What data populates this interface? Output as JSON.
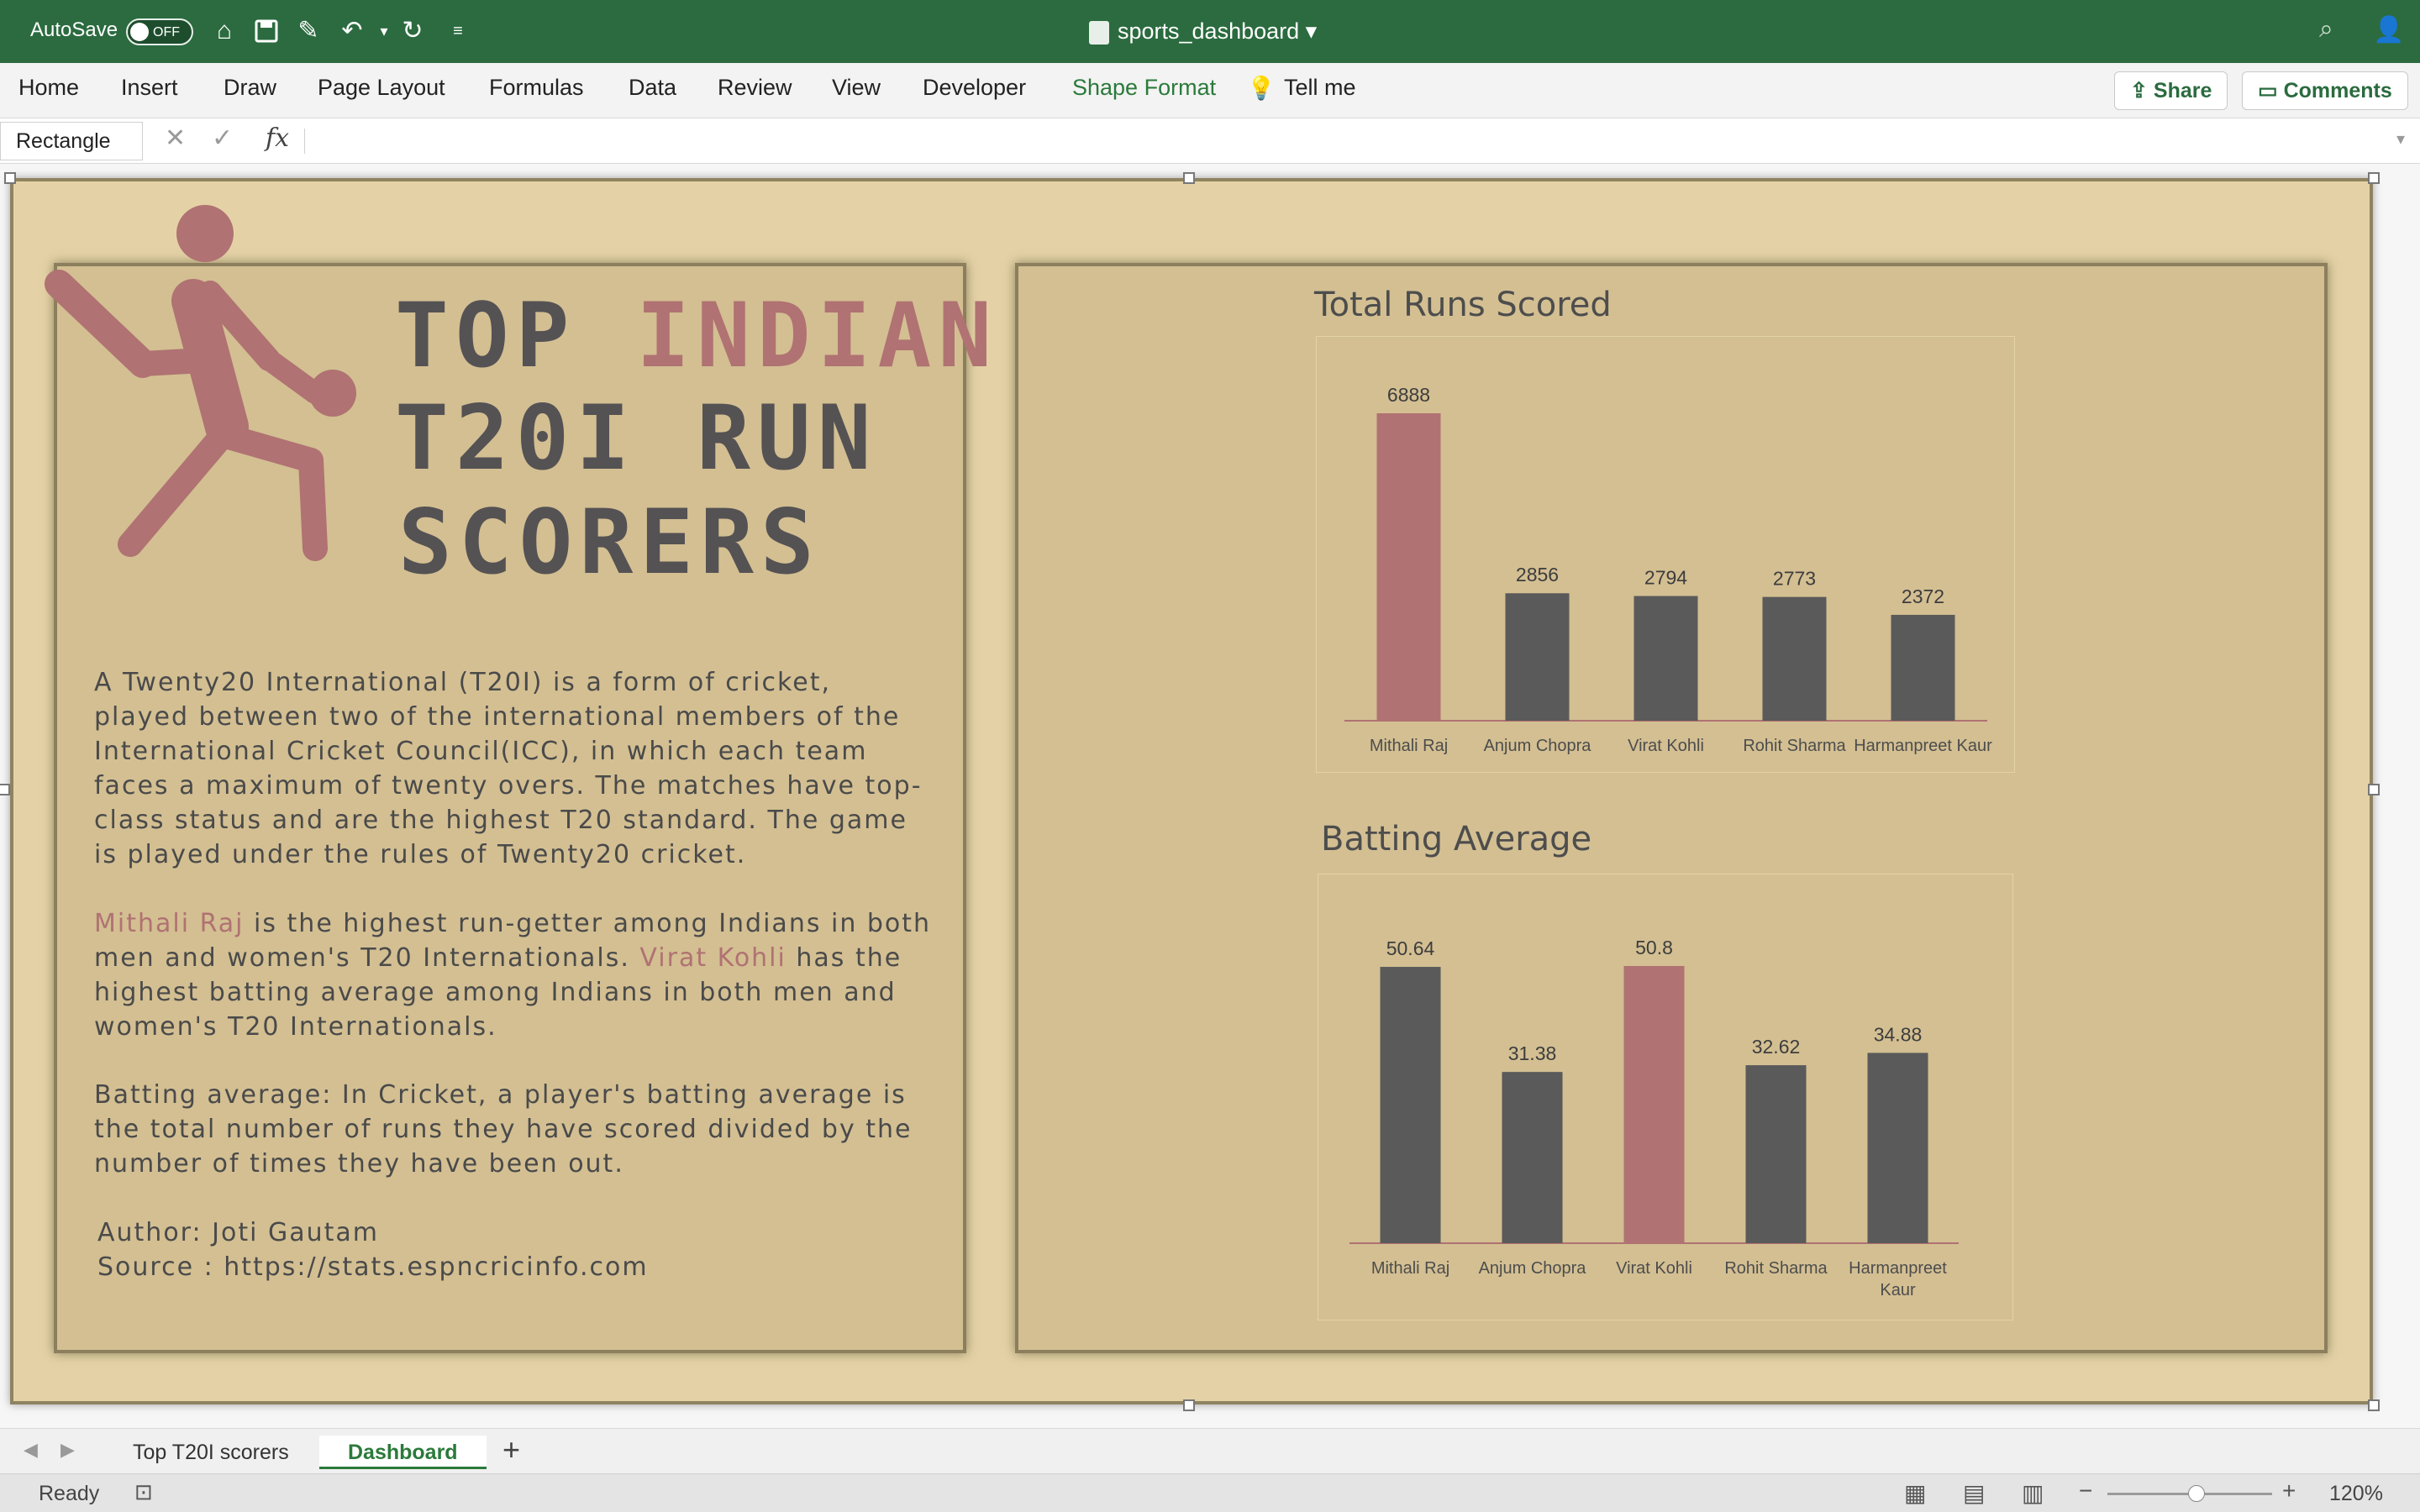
{
  "titlebar": {
    "autosave_label": "AutoSave",
    "autosave_state": "OFF",
    "doc_title": "sports_dashboard"
  },
  "ribbon": {
    "tabs": [
      "Home",
      "Insert",
      "Draw",
      "Page Layout",
      "Formulas",
      "Data",
      "Review",
      "View",
      "Developer",
      "Shape Format"
    ],
    "active_tab": "Shape Format",
    "tell_me": "Tell me",
    "share": "Share",
    "comments": "Comments"
  },
  "formula_bar": {
    "name_box": "Rectangle",
    "fx": "fx",
    "value": ""
  },
  "dashboard": {
    "title": {
      "part1": "TOP ",
      "accent": "INDIAN",
      "line2": "T20I RUN",
      "line3": "SCORERS"
    },
    "para1": "A Twenty20 International (T20I) is a form of cricket, played between two of the international members of the International Cricket Council(ICC), in which each team faces a maximum of twenty overs. The matches have top-class status and are the highest T20 standard. The game is played under the rules of Twenty20 cricket.",
    "para2": {
      "name1": "Mithali Raj",
      "text1": " is the highest run-getter among Indians in both men and women's T20 Internationals. ",
      "name2": "Virat Kohli",
      "text2": " has the highest batting average among Indians in both men and women's T20 Internationals."
    },
    "para3": "Batting average: In Cricket, a player's batting average is the total number of runs they have scored divided by the number of times they have been out.",
    "author": "Author: Joti Gautam",
    "source": "Source : https://stats.espncricinfo.com"
  },
  "chart_data": [
    {
      "type": "bar",
      "title": "Total Runs Scored",
      "categories": [
        "Mithali Raj",
        "Anjum Chopra",
        "Virat Kohli",
        "Rohit Sharma",
        "Harmanpreet Kaur"
      ],
      "values": [
        6888,
        2856,
        2794,
        2773,
        2372
      ],
      "ylim": [
        0,
        6888
      ],
      "highlight_index": 0,
      "colors": {
        "bar": "#5a5a5a",
        "highlight": "#b07272",
        "axis": "#b07272"
      }
    },
    {
      "type": "bar",
      "title": "Batting Average",
      "categories": [
        "Mithali Raj",
        "Anjum Chopra",
        "Virat Kohli",
        "Rohit Sharma",
        "Harmanpreet Kaur"
      ],
      "values": [
        50.64,
        31.38,
        50.8,
        32.62,
        34.88
      ],
      "ylim": [
        0,
        50.8
      ],
      "highlight_index": 2,
      "colors": {
        "bar": "#5a5a5a",
        "highlight": "#b07272",
        "axis": "#b07272"
      }
    }
  ],
  "sheet_tabs": [
    "Top T20I scorers",
    "Dashboard"
  ],
  "active_sheet": "Dashboard",
  "status": {
    "ready": "Ready",
    "zoom": "120%"
  },
  "colors": {
    "excel_green": "#2b6b3f",
    "panel": "#d3bf92",
    "accent": "#b07272",
    "dark_bar": "#5a5a5a"
  }
}
